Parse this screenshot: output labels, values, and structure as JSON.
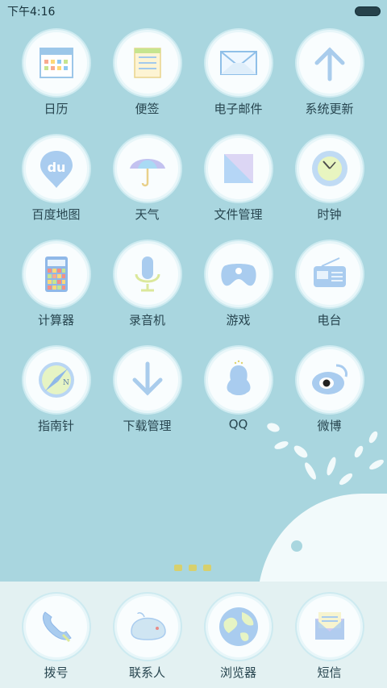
{
  "status": {
    "time": "下午4:16"
  },
  "pages_indicator_count": 3,
  "apps": [
    {
      "label": "日历",
      "icon": "calendar-icon"
    },
    {
      "label": "便签",
      "icon": "notes-icon"
    },
    {
      "label": "电子邮件",
      "icon": "mail-icon"
    },
    {
      "label": "系统更新",
      "icon": "update-arrow-icon"
    },
    {
      "label": "百度地图",
      "icon": "baidu-map-icon"
    },
    {
      "label": "天气",
      "icon": "umbrella-icon"
    },
    {
      "label": "文件管理",
      "icon": "folder-icon"
    },
    {
      "label": "时钟",
      "icon": "clock-icon"
    },
    {
      "label": "计算器",
      "icon": "calculator-icon"
    },
    {
      "label": "录音机",
      "icon": "microphone-icon"
    },
    {
      "label": "游戏",
      "icon": "gamepad-icon"
    },
    {
      "label": "电台",
      "icon": "radio-icon"
    },
    {
      "label": "指南针",
      "icon": "compass-icon"
    },
    {
      "label": "下载管理",
      "icon": "download-arrow-icon"
    },
    {
      "label": "QQ",
      "icon": "qq-penguin-icon"
    },
    {
      "label": "微博",
      "icon": "weibo-eye-icon"
    }
  ],
  "dock": [
    {
      "label": "拨号",
      "icon": "phone-icon"
    },
    {
      "label": "联系人",
      "icon": "whale-contacts-icon"
    },
    {
      "label": "浏览器",
      "icon": "globe-icon"
    },
    {
      "label": "短信",
      "icon": "message-envelope-icon"
    }
  ]
}
